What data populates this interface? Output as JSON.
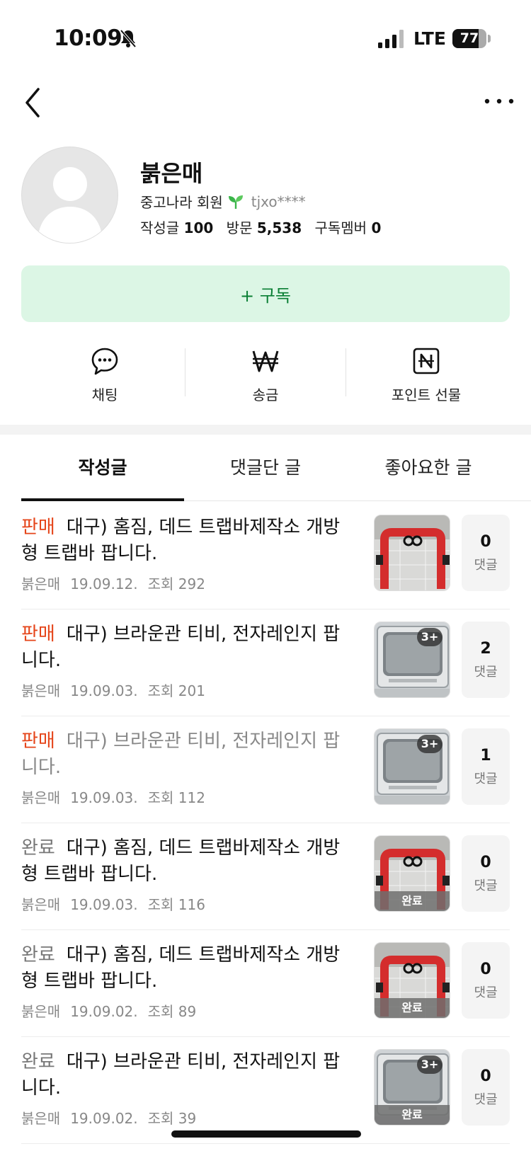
{
  "status_bar": {
    "time": "10:09",
    "network": "LTE",
    "battery_level": "77",
    "battery_fraction": 0.77,
    "icons": [
      "bell-slash-icon",
      "signal-icon",
      "battery-icon"
    ]
  },
  "header": {
    "back_icon": "chevron-left-icon",
    "more_icon": "more-dots-icon"
  },
  "profile": {
    "nickname": "붉은매",
    "member_type": "중고나라 회원",
    "user_id": "tjxo****",
    "stats": {
      "posts_label": "작성글",
      "posts_value": "100",
      "visits_label": "방문",
      "visits_value": "5,538",
      "subscribers_label": "구독멤버",
      "subscribers_value": "0"
    }
  },
  "subscribe_button": {
    "label": "+ 구독",
    "background": "#dcf6e5",
    "text_color": "#0a7f34"
  },
  "actions": [
    {
      "label": "채팅",
      "icon": "chat-bubble-icon"
    },
    {
      "label": "송금",
      "icon": "won-icon"
    },
    {
      "label": "포인트 선물",
      "icon": "naver-point-icon"
    }
  ],
  "tabs": [
    {
      "label": "작성글",
      "active": true
    },
    {
      "label": "댓글단 글",
      "active": false
    },
    {
      "label": "좋아요한 글",
      "active": false
    }
  ],
  "colors": {
    "sale_tag": "#e5451a",
    "done_tag": "#777777"
  },
  "posts": [
    {
      "tag": "판매",
      "title": "대구) 홈짐, 데드 트랩바제작소 개방형 트랩바 팝니다.",
      "author": "붉은매",
      "date": "19.09.12.",
      "views": "조회 292",
      "image_count": "",
      "done_label": "",
      "comments": "0",
      "comments_label": "댓글"
    },
    {
      "tag": "판매",
      "title": "대구) 브라운관 티비, 전자레인지 팝니다.",
      "author": "붉은매",
      "date": "19.09.03.",
      "views": "조회 201",
      "image_count": "3+",
      "done_label": "",
      "comments": "2",
      "comments_label": "댓글"
    },
    {
      "tag": "판매",
      "title": "대구) 브라운관 티비, 전자레인지 팝니다.",
      "author": "붉은매",
      "date": "19.09.03.",
      "views": "조회 112",
      "image_count": "3+",
      "done_label": "",
      "comments": "1",
      "comments_label": "댓글"
    },
    {
      "tag": "완료",
      "title": "대구) 홈짐, 데드 트랩바제작소 개방형 트랩바 팝니다.",
      "author": "붉은매",
      "date": "19.09.03.",
      "views": "조회 116",
      "image_count": "",
      "done_label": "완료",
      "comments": "0",
      "comments_label": "댓글"
    },
    {
      "tag": "완료",
      "title": "대구) 홈짐, 데드 트랩바제작소 개방형 트랩바 팝니다.",
      "author": "붉은매",
      "date": "19.09.02.",
      "views": "조회 89",
      "image_count": "",
      "done_label": "완료",
      "comments": "0",
      "comments_label": "댓글"
    },
    {
      "tag": "완료",
      "title": "대구) 브라운관 티비, 전자레인지 팝니다.",
      "author": "붉은매",
      "date": "19.09.02.",
      "views": "조회 39",
      "image_count": "3+",
      "done_label": "완료",
      "comments": "0",
      "comments_label": "댓글"
    }
  ]
}
